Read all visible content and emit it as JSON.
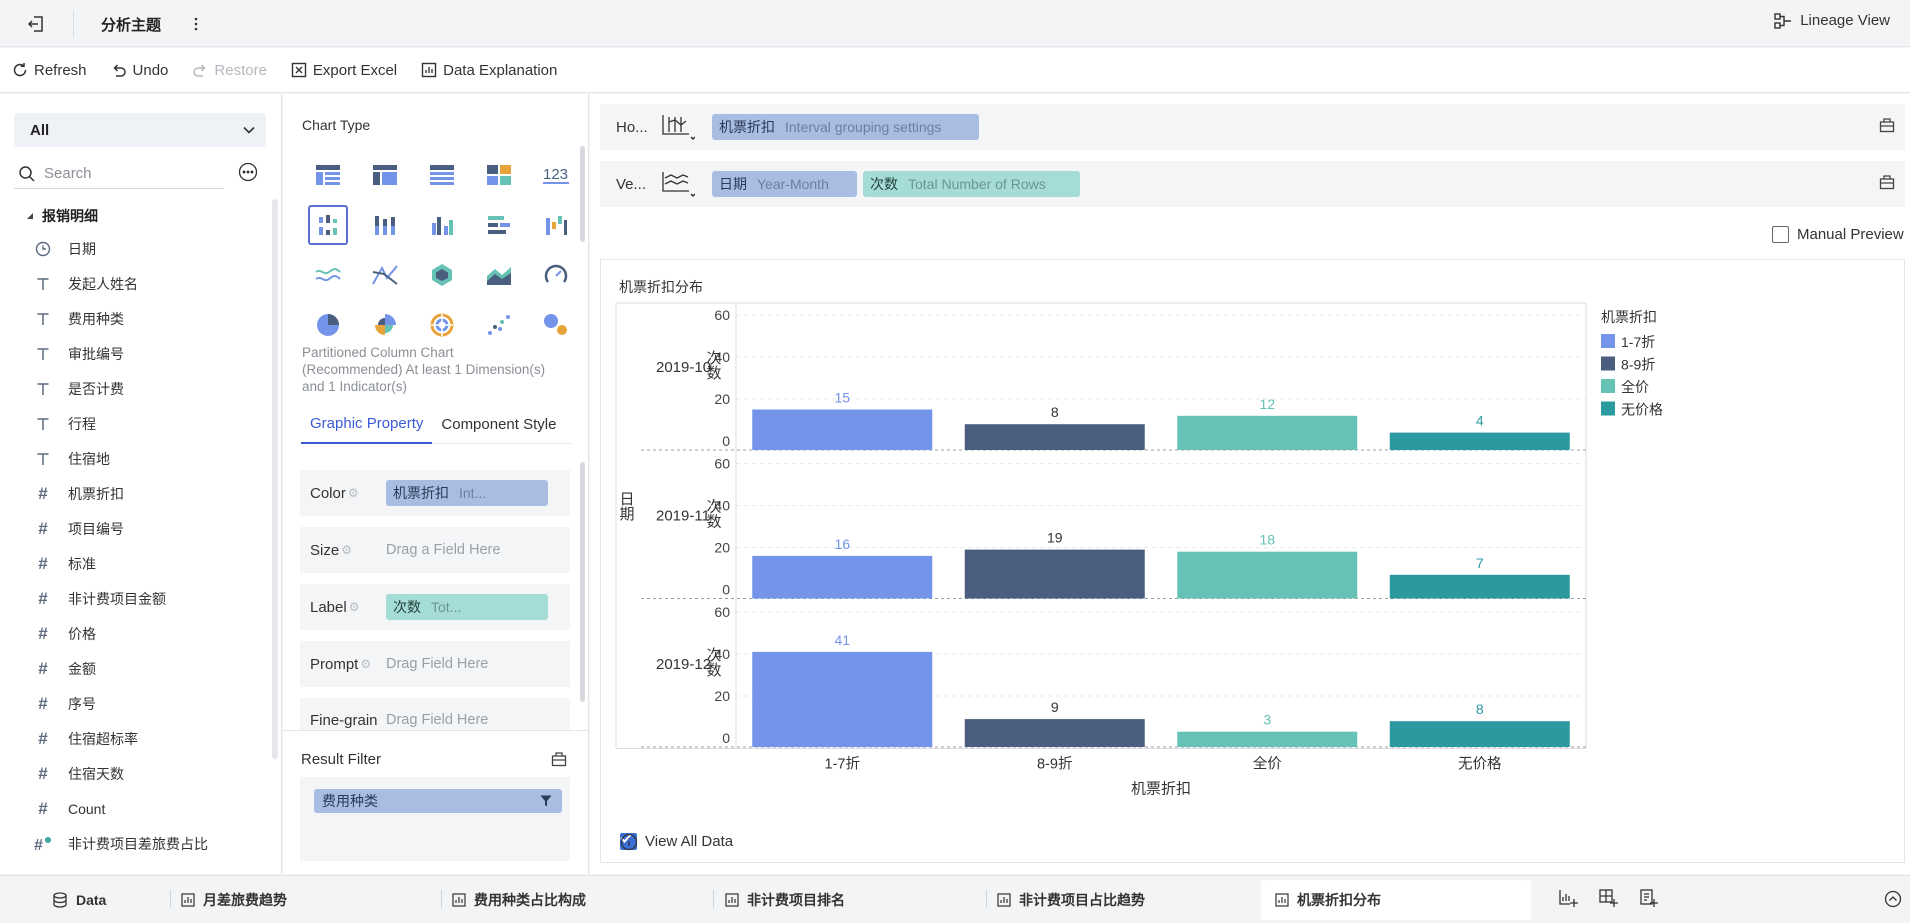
{
  "topbar": {
    "title": "分析主题",
    "lineage": "Lineage View"
  },
  "toolbar": {
    "refresh": "Refresh",
    "undo": "Undo",
    "restore": "Restore",
    "export": "Export Excel",
    "explain": "Data Explanation"
  },
  "left": {
    "select_value": "All",
    "search_placeholder": "Search",
    "group": "报销明细",
    "fields": [
      {
        "type": "date",
        "label": "日期"
      },
      {
        "type": "text",
        "label": "发起人姓名"
      },
      {
        "type": "text",
        "label": "费用种类"
      },
      {
        "type": "text",
        "label": "审批编号"
      },
      {
        "type": "text",
        "label": "是否计费"
      },
      {
        "type": "text",
        "label": "行程"
      },
      {
        "type": "text",
        "label": "住宿地"
      },
      {
        "type": "number",
        "label": "机票折扣"
      },
      {
        "type": "number",
        "label": "项目编号"
      },
      {
        "type": "number",
        "label": "标准"
      },
      {
        "type": "number",
        "label": "非计费项目金额"
      },
      {
        "type": "number",
        "label": "价格"
      },
      {
        "type": "number",
        "label": "金额"
      },
      {
        "type": "number",
        "label": "序号"
      },
      {
        "type": "number",
        "label": "住宿超标率"
      },
      {
        "type": "number",
        "label": "住宿天数"
      },
      {
        "type": "number",
        "label": "Count"
      },
      {
        "type": "calc",
        "label": "非计费项目差旅费占比"
      }
    ]
  },
  "mid": {
    "chart_type_title": "Chart Type",
    "hint": "Partitioned Column Chart (Recommended) At least 1 Dimension(s) and 1 Indicator(s)",
    "tabs": [
      "Graphic Property",
      "Component Style"
    ],
    "props": {
      "color": {
        "label": "Color",
        "pill": "机票折扣",
        "sub": "Int..."
      },
      "size": {
        "label": "Size",
        "drag": "Drag a Field Here"
      },
      "label": {
        "label": "Label",
        "pill": "次数",
        "sub": "Tot..."
      },
      "prompt": {
        "label": "Prompt",
        "drag": "Drag Field Here"
      },
      "fine": {
        "label": "Fine-grain",
        "drag": "Drag Field Here"
      }
    },
    "result_filter": {
      "title": "Result Filter",
      "pill": "费用种类"
    }
  },
  "shelves": {
    "horizontal": {
      "label": "Ho...",
      "pill": "机票折扣",
      "sub": "Interval grouping settings"
    },
    "vertical": {
      "label": "Ve...",
      "pill1": "日期",
      "sub1": "Year-Month",
      "pill2": "次数",
      "sub2": "Total Number of Rows"
    }
  },
  "manual_preview": "Manual Preview",
  "view_all_data": "View All Data",
  "colors": {
    "c1": "#7394e8",
    "c2": "#4a5e80",
    "c3": "#66c2b5",
    "c4": "#2a9aa0",
    "accent": "#3b5bd6"
  },
  "chart_data": {
    "type": "bar",
    "title": "机票折扣分布",
    "xlabel": "机票折扣",
    "row_label": "日期",
    "ylabel": "次数",
    "categories": [
      "1-7折",
      "8-9折",
      "全价",
      "无价格"
    ],
    "panels": [
      {
        "name": "2019-10",
        "values": [
          15,
          8,
          12,
          4
        ]
      },
      {
        "name": "2019-11",
        "values": [
          16,
          19,
          18,
          7
        ]
      },
      {
        "name": "2019-12",
        "values": [
          41,
          9,
          3,
          8
        ]
      }
    ],
    "ylim": [
      0,
      60
    ],
    "yticks": [
      0,
      20,
      40,
      60
    ],
    "legend_title": "机票折扣",
    "legend": [
      "1-7折",
      "8-9折",
      "全价",
      "无价格"
    ],
    "legend_position": "right",
    "grid": true
  },
  "bottom": {
    "data_tab": "Data",
    "tabs": [
      "月差旅费趋势",
      "费用种类占比构成",
      "非计费项目排名",
      "非计费项目占比趋势",
      "机票折扣分布"
    ]
  }
}
